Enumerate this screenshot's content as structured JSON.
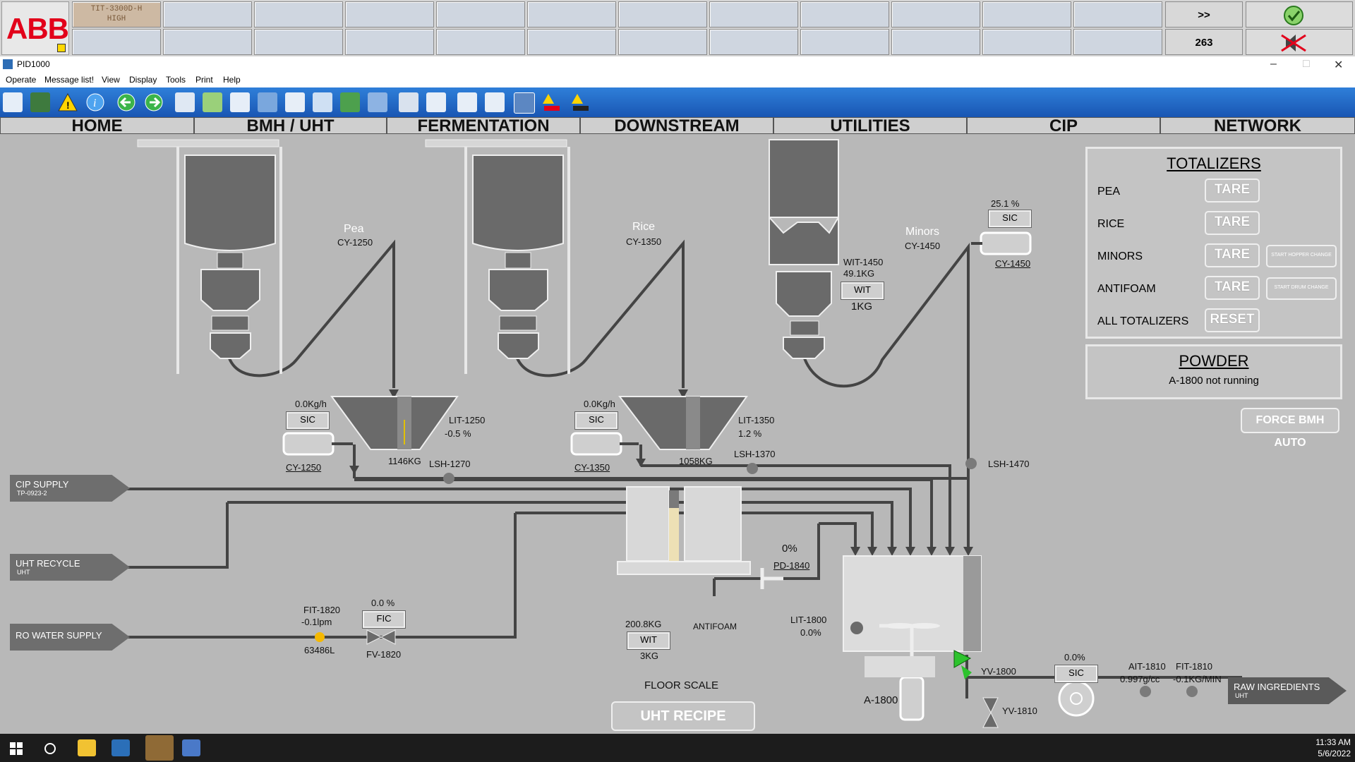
{
  "banner": {
    "logo": "ABB",
    "first_alarm": [
      "TIT-3300D-H",
      "HIGH"
    ],
    "more_label": ">>",
    "count": "263"
  },
  "window": {
    "title": "PID1000",
    "min": "–",
    "max": "□",
    "close": "✕"
  },
  "menu": [
    "Operate",
    "Message list!",
    "View",
    "Display",
    "Tools",
    "Print",
    "Help"
  ],
  "nav": [
    "HOME",
    "BMH / UHT",
    "FERMENTATION",
    "DOWNSTREAM",
    "UTILITIES",
    "CIP",
    "NETWORK"
  ],
  "process": {
    "pea": {
      "name": "Pea",
      "conveyor": "CY-1250",
      "flow": "0.0Kg/h",
      "sic": "SIC",
      "motor": "CY-1250",
      "lit": "LIT-1250",
      "level": "-0.5 %",
      "weight": "1146KG",
      "lsh": "LSH-1270"
    },
    "rice": {
      "name": "Rice",
      "conveyor": "CY-1350",
      "flow": "0.0Kg/h",
      "sic": "SIC",
      "motor": "CY-1350",
      "lit": "LIT-1350",
      "level": "1.2 %",
      "weight": "1058KG",
      "lsh": "LSH-1370"
    },
    "minors": {
      "name": "Minors",
      "conveyor": "CY-1450",
      "speed": "25.1 %",
      "sic": "SIC",
      "motor": "CY-1450",
      "wit": "WIT-1450",
      "wit_value": "49.1KG",
      "wit_tag": "WIT",
      "wit_set": "1KG",
      "lsh": "LSH-1470"
    },
    "supplies": [
      {
        "label": "CIP SUPPLY",
        "sub": "TP-0923-2"
      },
      {
        "label": "UHT RECYCLE",
        "sub": "UHT"
      },
      {
        "label": "RO WATER SUPPLY",
        "sub": ""
      }
    ],
    "fit1820": {
      "tag": "FIT-1820",
      "value": "-0.1lpm",
      "total": "63486L"
    },
    "fv1820": {
      "output": "0.0 %",
      "fic": "FIC",
      "valve": "FV-1820"
    },
    "pd1840": {
      "value": "0%",
      "tag": "PD-1840"
    },
    "floor_scale": {
      "weight": "200.8KG",
      "wit": "WIT",
      "set": "3KG",
      "antifoam": "ANTIFOAM",
      "label": "FLOOR SCALE"
    },
    "lit1800": {
      "tag": "LIT-1800",
      "value": "0.0%"
    },
    "a1800": "A-1800",
    "yv1800": "YV-1800",
    "yv1810": "YV-1810",
    "pump": {
      "speed": "0.0%",
      "sic": "SIC"
    },
    "ait1810": {
      "tag": "AIT-1810",
      "value": "0.997g/cc"
    },
    "fit1810": {
      "tag": "FIT-1810",
      "value": "-0.1KG/MIN"
    },
    "raw": {
      "label": "RAW INGREDIENTS",
      "sub": "UHT"
    }
  },
  "totalizers": {
    "title": "TOTALIZERS",
    "rows": [
      {
        "label": "PEA",
        "button": "TARE",
        "extra": ""
      },
      {
        "label": "RICE",
        "button": "TARE",
        "extra": ""
      },
      {
        "label": "MINORS",
        "button": "TARE",
        "extra": "START HOPPER CHANGE"
      },
      {
        "label": "ANTIFOAM",
        "button": "TARE",
        "extra": "START DRUM CHANGE"
      },
      {
        "label": "ALL TOTALIZERS",
        "button": "RESET",
        "extra": ""
      }
    ]
  },
  "powder": {
    "title": "POWDER",
    "status": "A-1800 not running"
  },
  "force_bmh": "FORCE BMH AUTO",
  "uht_recipe": "UHT RECIPE",
  "clock": {
    "time": "11:33 AM",
    "date": "5/6/2022"
  }
}
